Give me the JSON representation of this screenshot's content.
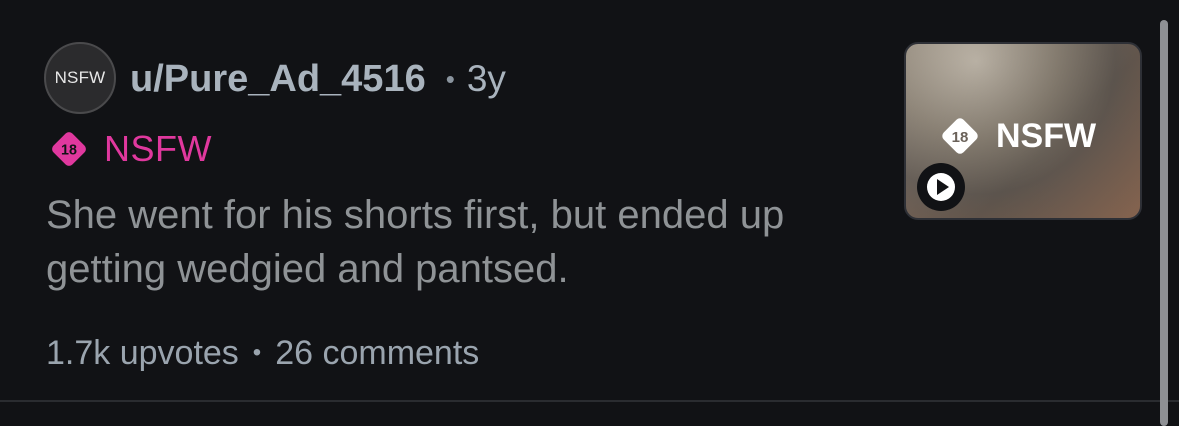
{
  "post": {
    "avatar_text": "NSFW",
    "username": "u/Pure_Ad_4516",
    "separator": "•",
    "age": "3y",
    "tag_age": "18",
    "tag_label": "NSFW",
    "title": "She went for his shorts first, but ended up getting wedgied and pantsed.",
    "upvotes": "1.7k upvotes",
    "comments": "26 comments",
    "thumbnail": {
      "badge_age": "18",
      "badge_label": "NSFW",
      "media_icon": "play-icon"
    }
  },
  "colors": {
    "background": "#111215",
    "nsfw_accent": "#e0389e",
    "meta_text": "#a9b3bd",
    "title_text": "#8f9396"
  }
}
